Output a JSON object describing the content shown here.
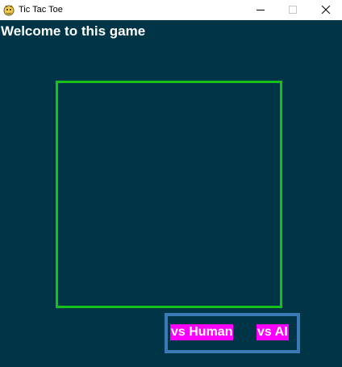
{
  "window": {
    "title": "Tic Tac Toe",
    "icon": "pygame-snake-icon",
    "controls": {
      "minimize_icon": "minimize-icon",
      "maximize_icon": "maximize-icon",
      "close_icon": "close-icon"
    }
  },
  "game": {
    "welcome_text": "Welcome to this game",
    "board_color": "#15c018",
    "background_color": "#003548"
  },
  "mode_select": {
    "vs_human_label": "vs Human",
    "vs_ai_label": "vs AI",
    "button_color": "#ff00ff",
    "panel_border_color": "#3a7ab4"
  }
}
